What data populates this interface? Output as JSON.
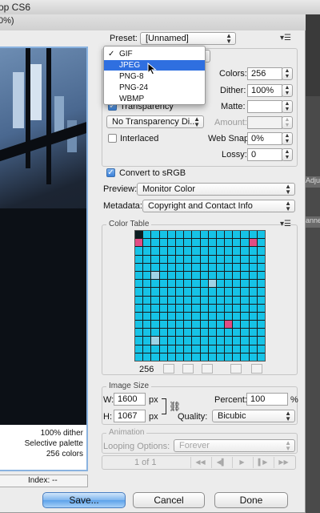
{
  "background_app": {
    "title": "op CS6",
    "subtitle": "0%)",
    "right_tabs": [
      "Adjustm",
      "annel"
    ]
  },
  "preview": {
    "info_lines": [
      "100% dither",
      "Selective palette",
      "256 colors"
    ],
    "index_label": "Index: --"
  },
  "preset": {
    "label": "Preset:",
    "value": "[Unnamed]"
  },
  "format_menu": {
    "items": [
      {
        "label": "GIF",
        "checked": true,
        "selected": false
      },
      {
        "label": "JPEG",
        "checked": false,
        "selected": true
      },
      {
        "label": "PNG-8",
        "checked": false,
        "selected": false
      },
      {
        "label": "PNG-24",
        "checked": false,
        "selected": false
      },
      {
        "label": "WBMP",
        "checked": false,
        "selected": false
      }
    ]
  },
  "settings": {
    "colors_label": "Colors:",
    "colors_value": "256",
    "dither_label": "Dither:",
    "dither_value": "100%",
    "matte_label": "Matte:",
    "matte_value": "",
    "amount_label": "Amount:",
    "amount_value": "",
    "web_snap_label": "Web Snap:",
    "web_snap_value": "0%",
    "lossy_label": "Lossy:",
    "lossy_value": "0",
    "transparency_label": "Transparency",
    "transparency_dither": "No Transparency Di...",
    "interlaced_label": "Interlaced",
    "interlaced_checked": false,
    "convert_srgb_label": "Convert to sRGB",
    "convert_srgb_checked": true,
    "preview_label": "Preview:",
    "preview_value": "Monitor Color",
    "metadata_label": "Metadata:",
    "metadata_value": "Copyright and Contact Info"
  },
  "color_table": {
    "title": "Color Table",
    "count": "256",
    "colors": [
      "#16c3e6",
      "#0f2a38",
      "#61a8b8",
      "#d8c6f0",
      "#0c1e22",
      "#3d5a66",
      "#24c7e9",
      "#1d4b5a",
      "#e04d84",
      "#9fd3e6",
      "#132830",
      "#2d6e7d",
      "#88e0f5",
      "#0b151a",
      "#5e3f66",
      "#c5e4ef"
    ]
  },
  "image_size": {
    "title": "Image Size",
    "w_label": "W:",
    "w_value": "1600",
    "h_label": "H:",
    "h_value": "1067",
    "unit": "px",
    "percent_label": "Percent:",
    "percent_value": "100",
    "percent_unit": "%",
    "quality_label": "Quality:",
    "quality_value": "Bicubic"
  },
  "animation": {
    "title": "Animation",
    "looping_label": "Looping Options:",
    "looping_value": "Forever",
    "frame_counter": "1 of 1"
  },
  "buttons": {
    "save": "Save...",
    "cancel": "Cancel",
    "done": "Done"
  }
}
